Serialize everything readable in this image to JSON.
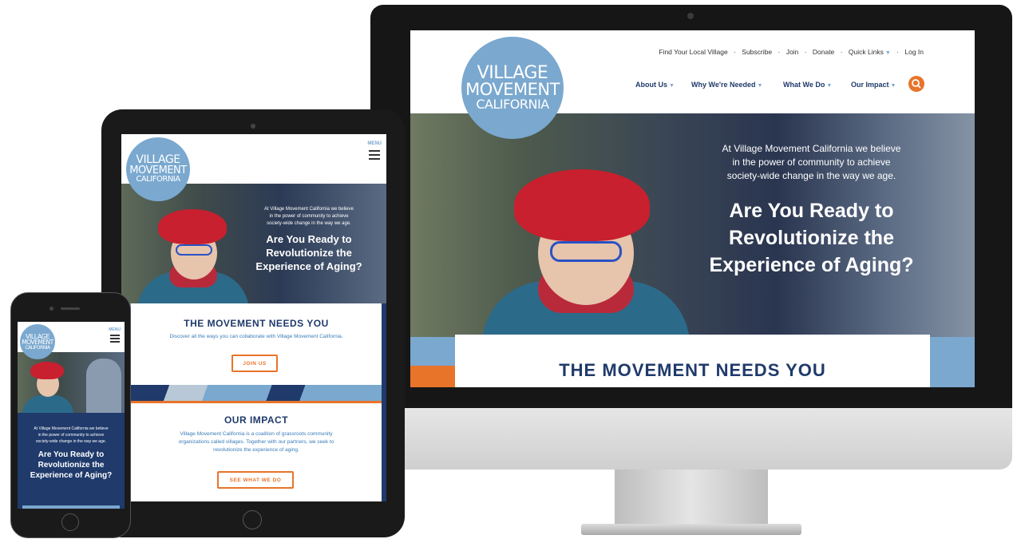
{
  "site": {
    "logo": {
      "line1": "VILLAGE",
      "line2": "MOVEMENT",
      "line3": "CALIFORNIA"
    },
    "utility_nav": [
      "Find Your Local Village",
      "Subscribe",
      "Join",
      "Donate",
      "Quick Links",
      "Log In"
    ],
    "separator": "·",
    "main_nav": [
      "About Us",
      "Why We're Needed",
      "What We Do",
      "Our Impact"
    ],
    "menu_label": "MENU",
    "hero": {
      "intro": "At Village Movement California we believe in the power of community to achieve society-wide change in the way we age.",
      "intro_lines": [
        "At Village Movement California we believe",
        "in the power of community to achieve",
        "society-wide change in the way we age."
      ],
      "headline_lines": [
        "Are You Ready to",
        "Revolutionize the",
        "Experience of Aging?"
      ]
    },
    "movement": {
      "title": "THE MOVEMENT NEEDS YOU",
      "text": "Discover all the ways you can collaborate with Village Movement California.",
      "button": "JOIN US"
    },
    "impact": {
      "title": "OUR IMPACT",
      "text_lines": [
        "Village Movement California is a coalition of grassroots community",
        "organizations called villages. Together with our partners, we seek to",
        "revolutionize the experience of aging."
      ],
      "button": "SEE WHAT WE DO"
    }
  },
  "colors": {
    "navy": "#1f3a6b",
    "logo_blue": "#7aa8cf",
    "accent_orange": "#e8742a",
    "device_black": "#1a1a1a"
  },
  "icons": [
    "search-icon",
    "hamburger-menu-icon",
    "chevron-down-icon"
  ]
}
